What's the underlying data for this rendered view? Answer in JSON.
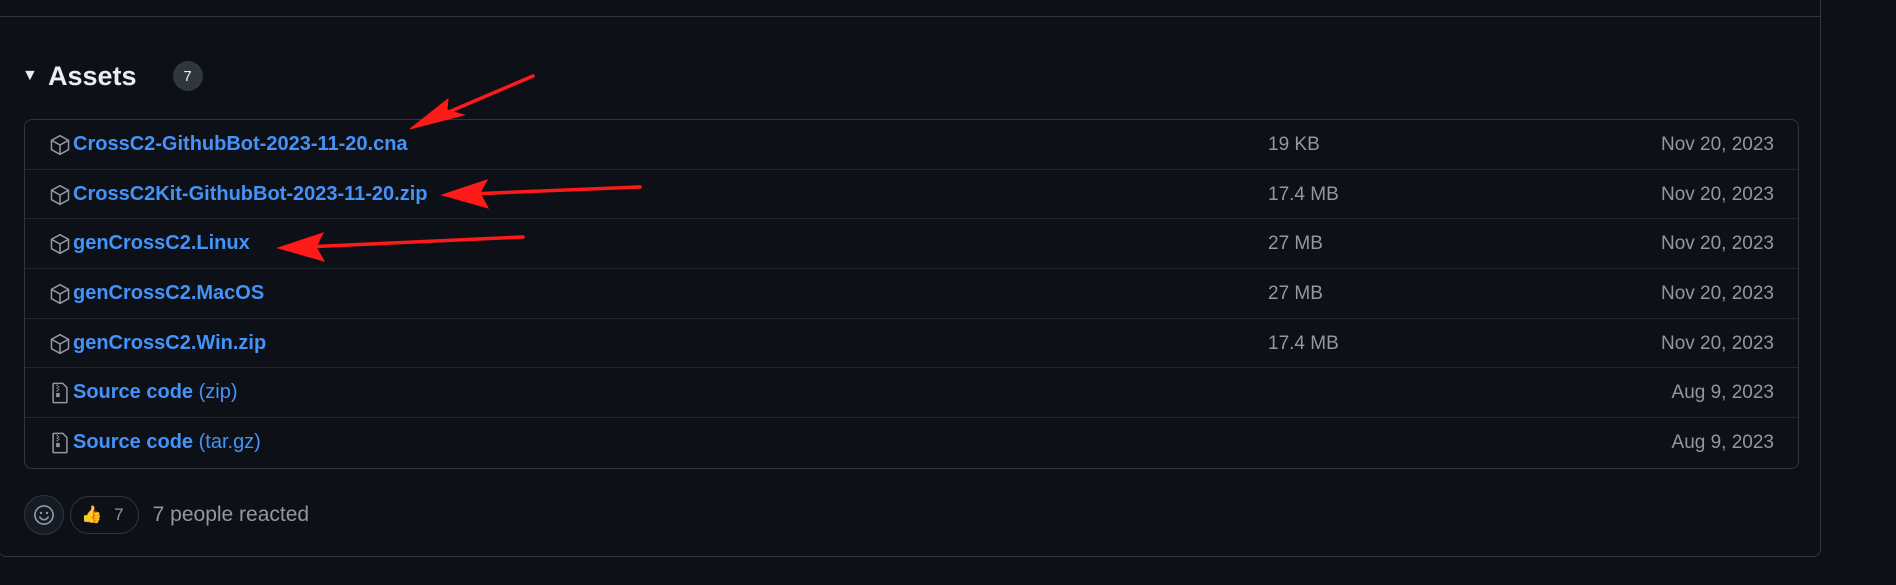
{
  "assets": {
    "title": "Assets",
    "count": "7",
    "items": [
      {
        "name": "CrossC2-GithubBot-2023-11-20.cna",
        "suffix": "",
        "size": "19 KB",
        "date": "Nov 20, 2023",
        "icon": "package-icon"
      },
      {
        "name": "CrossC2Kit-GithubBot-2023-11-20.zip",
        "suffix": "",
        "size": "17.4 MB",
        "date": "Nov 20, 2023",
        "icon": "package-icon"
      },
      {
        "name": "genCrossC2.Linux",
        "suffix": "",
        "size": "27 MB",
        "date": "Nov 20, 2023",
        "icon": "package-icon"
      },
      {
        "name": "genCrossC2.MacOS",
        "suffix": "",
        "size": "27 MB",
        "date": "Nov 20, 2023",
        "icon": "package-icon"
      },
      {
        "name": "genCrossC2.Win.zip",
        "suffix": "",
        "size": "17.4 MB",
        "date": "Nov 20, 2023",
        "icon": "package-icon"
      },
      {
        "name": "Source code",
        "suffix": "(zip)",
        "size": "",
        "date": "Aug 9, 2023",
        "icon": "file-zip-icon"
      },
      {
        "name": "Source code",
        "suffix": "(tar.gz)",
        "size": "",
        "date": "Aug 9, 2023",
        "icon": "file-zip-icon"
      }
    ]
  },
  "reactions": {
    "emoji": "👍",
    "count": "7",
    "summary": "7 people reacted"
  },
  "colors": {
    "background": "#0d1117",
    "border": "#30363d",
    "link": "#4493f8",
    "muted": "#9198a1",
    "annotation_arrow": "#ff1a1a"
  }
}
